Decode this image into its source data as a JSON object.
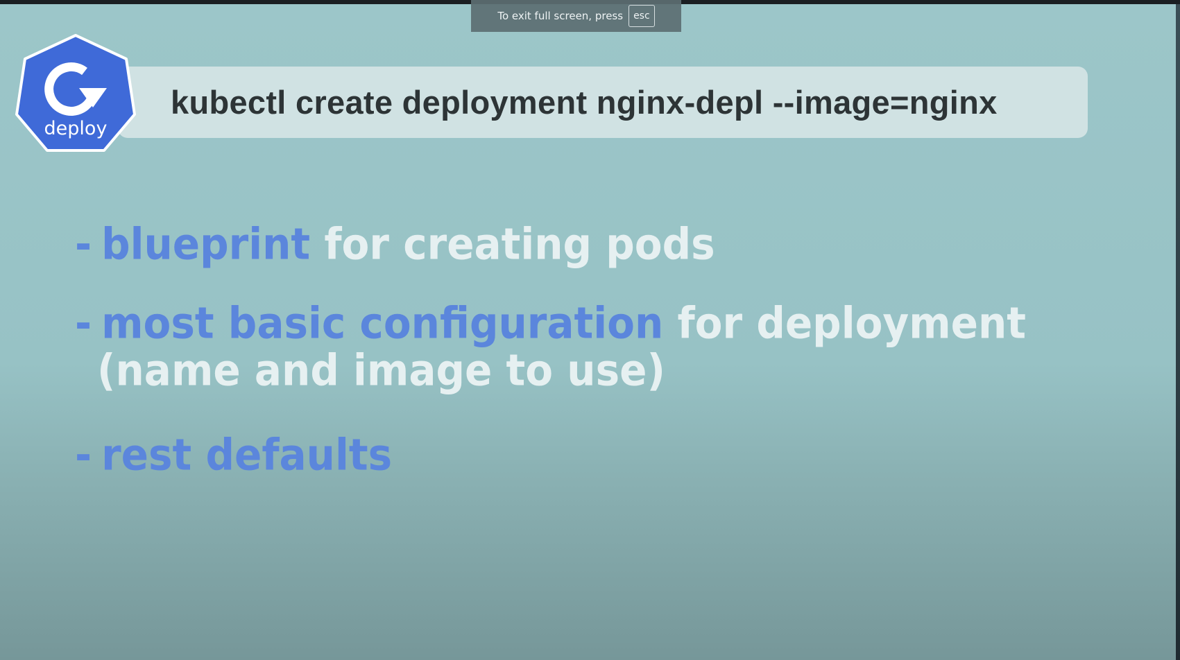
{
  "fullscreen_notice": {
    "text": "To exit full screen, press",
    "key": "esc"
  },
  "slide": {
    "badge": {
      "icon": "deploy-rotate-arrow-icon",
      "label": "deploy",
      "color": "#3f6ad8"
    },
    "command": "kubectl create deployment nginx-depl --image=nginx",
    "bullets": [
      {
        "dash": "-",
        "highlight": "blueprint",
        "rest": "for creating pods"
      },
      {
        "dash": "-",
        "highlight": "most basic configuration",
        "rest": "for deployment",
        "continuation": "(name and image to use)"
      },
      {
        "dash": "-",
        "highlight": "rest defaults",
        "rest": ""
      }
    ],
    "colors": {
      "highlight": "#5b86dc",
      "plain_text": "#e6f0f1",
      "background": "#9cc6c9"
    }
  }
}
